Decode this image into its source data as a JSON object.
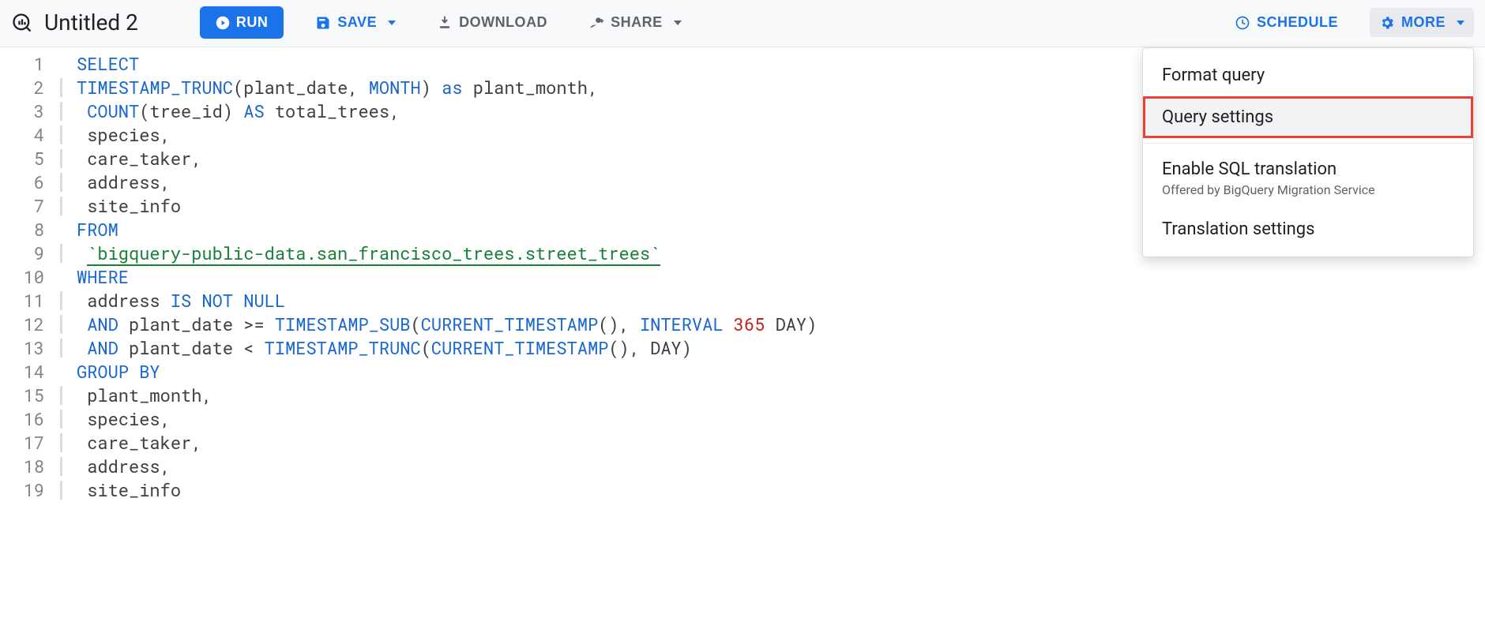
{
  "header": {
    "title": "Untitled 2",
    "run": "RUN",
    "save": "SAVE",
    "download": "DOWNLOAD",
    "share": "SHARE",
    "schedule": "SCHEDULE",
    "more": "MORE"
  },
  "more_menu": {
    "format": "Format query",
    "settings": "Query settings",
    "translate": "Enable SQL translation",
    "translate_sub": "Offered by BigQuery Migration Service",
    "translate_settings": "Translation settings"
  },
  "editor": {
    "lines": [
      {
        "n": 1,
        "bar": false,
        "t": [
          [
            "kw",
            "SELECT"
          ]
        ]
      },
      {
        "n": 2,
        "bar": true,
        "t": [
          [
            "func",
            "TIMESTAMP_TRUNC"
          ],
          [
            "",
            "(plant_date, "
          ],
          [
            "func",
            "MONTH"
          ],
          [
            "",
            ") "
          ],
          [
            "kw",
            "as"
          ],
          [
            "",
            " plant_month,"
          ]
        ]
      },
      {
        "n": 3,
        "bar": true,
        "t": [
          [
            "",
            " "
          ],
          [
            "func",
            "COUNT"
          ],
          [
            "",
            "(tree_id) "
          ],
          [
            "kw",
            "AS"
          ],
          [
            "",
            " total_trees,"
          ]
        ]
      },
      {
        "n": 4,
        "bar": true,
        "t": [
          [
            "",
            " species,"
          ]
        ]
      },
      {
        "n": 5,
        "bar": true,
        "t": [
          [
            "",
            " care_taker,"
          ]
        ]
      },
      {
        "n": 6,
        "bar": true,
        "t": [
          [
            "",
            " address,"
          ]
        ]
      },
      {
        "n": 7,
        "bar": true,
        "t": [
          [
            "",
            " site_info"
          ]
        ]
      },
      {
        "n": 8,
        "bar": false,
        "t": [
          [
            "kw",
            "FROM"
          ]
        ]
      },
      {
        "n": 9,
        "bar": true,
        "t": [
          [
            "",
            " "
          ],
          [
            "tbl",
            "`bigquery-public-data.san_francisco_trees.street_trees`"
          ]
        ]
      },
      {
        "n": 10,
        "bar": false,
        "t": [
          [
            "kw",
            "WHERE"
          ]
        ]
      },
      {
        "n": 11,
        "bar": true,
        "t": [
          [
            "",
            " address "
          ],
          [
            "kw",
            "IS"
          ],
          [
            "",
            " "
          ],
          [
            "kw",
            "NOT"
          ],
          [
            "",
            " "
          ],
          [
            "kw",
            "NULL"
          ]
        ]
      },
      {
        "n": 12,
        "bar": true,
        "t": [
          [
            "",
            " "
          ],
          [
            "kw",
            "AND"
          ],
          [
            "",
            " plant_date >= "
          ],
          [
            "func",
            "TIMESTAMP_SUB"
          ],
          [
            "",
            "("
          ],
          [
            "func",
            "CURRENT_TIMESTAMP"
          ],
          [
            "",
            "(), "
          ],
          [
            "kw",
            "INTERVAL"
          ],
          [
            "",
            " "
          ],
          [
            "num",
            "365"
          ],
          [
            "",
            " DAY)"
          ]
        ]
      },
      {
        "n": 13,
        "bar": true,
        "t": [
          [
            "",
            " "
          ],
          [
            "kw",
            "AND"
          ],
          [
            "",
            " plant_date < "
          ],
          [
            "func",
            "TIMESTAMP_TRUNC"
          ],
          [
            "",
            "("
          ],
          [
            "func",
            "CURRENT_TIMESTAMP"
          ],
          [
            "",
            "(), DAY)"
          ]
        ]
      },
      {
        "n": 14,
        "bar": false,
        "t": [
          [
            "kw",
            "GROUP BY"
          ]
        ]
      },
      {
        "n": 15,
        "bar": true,
        "t": [
          [
            "",
            " plant_month,"
          ]
        ]
      },
      {
        "n": 16,
        "bar": true,
        "t": [
          [
            "",
            " species,"
          ]
        ]
      },
      {
        "n": 17,
        "bar": true,
        "t": [
          [
            "",
            " care_taker,"
          ]
        ]
      },
      {
        "n": 18,
        "bar": true,
        "t": [
          [
            "",
            " address,"
          ]
        ]
      },
      {
        "n": 19,
        "bar": true,
        "t": [
          [
            "",
            " site_info"
          ]
        ]
      }
    ]
  }
}
